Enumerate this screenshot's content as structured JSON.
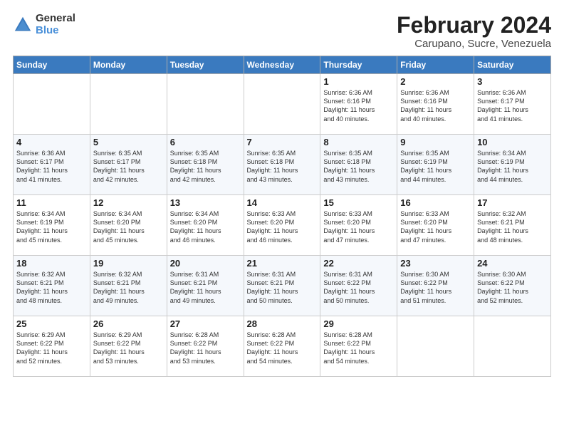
{
  "header": {
    "logo_general": "General",
    "logo_blue": "Blue",
    "title": "February 2024",
    "subtitle": "Carupano, Sucre, Venezuela"
  },
  "days_of_week": [
    "Sunday",
    "Monday",
    "Tuesday",
    "Wednesday",
    "Thursday",
    "Friday",
    "Saturday"
  ],
  "weeks": [
    [
      {
        "day": "",
        "info": ""
      },
      {
        "day": "",
        "info": ""
      },
      {
        "day": "",
        "info": ""
      },
      {
        "day": "",
        "info": ""
      },
      {
        "day": "1",
        "info": "Sunrise: 6:36 AM\nSunset: 6:16 PM\nDaylight: 11 hours\nand 40 minutes."
      },
      {
        "day": "2",
        "info": "Sunrise: 6:36 AM\nSunset: 6:16 PM\nDaylight: 11 hours\nand 40 minutes."
      },
      {
        "day": "3",
        "info": "Sunrise: 6:36 AM\nSunset: 6:17 PM\nDaylight: 11 hours\nand 41 minutes."
      }
    ],
    [
      {
        "day": "4",
        "info": "Sunrise: 6:36 AM\nSunset: 6:17 PM\nDaylight: 11 hours\nand 41 minutes."
      },
      {
        "day": "5",
        "info": "Sunrise: 6:35 AM\nSunset: 6:17 PM\nDaylight: 11 hours\nand 42 minutes."
      },
      {
        "day": "6",
        "info": "Sunrise: 6:35 AM\nSunset: 6:18 PM\nDaylight: 11 hours\nand 42 minutes."
      },
      {
        "day": "7",
        "info": "Sunrise: 6:35 AM\nSunset: 6:18 PM\nDaylight: 11 hours\nand 43 minutes."
      },
      {
        "day": "8",
        "info": "Sunrise: 6:35 AM\nSunset: 6:18 PM\nDaylight: 11 hours\nand 43 minutes."
      },
      {
        "day": "9",
        "info": "Sunrise: 6:35 AM\nSunset: 6:19 PM\nDaylight: 11 hours\nand 44 minutes."
      },
      {
        "day": "10",
        "info": "Sunrise: 6:34 AM\nSunset: 6:19 PM\nDaylight: 11 hours\nand 44 minutes."
      }
    ],
    [
      {
        "day": "11",
        "info": "Sunrise: 6:34 AM\nSunset: 6:19 PM\nDaylight: 11 hours\nand 45 minutes."
      },
      {
        "day": "12",
        "info": "Sunrise: 6:34 AM\nSunset: 6:20 PM\nDaylight: 11 hours\nand 45 minutes."
      },
      {
        "day": "13",
        "info": "Sunrise: 6:34 AM\nSunset: 6:20 PM\nDaylight: 11 hours\nand 46 minutes."
      },
      {
        "day": "14",
        "info": "Sunrise: 6:33 AM\nSunset: 6:20 PM\nDaylight: 11 hours\nand 46 minutes."
      },
      {
        "day": "15",
        "info": "Sunrise: 6:33 AM\nSunset: 6:20 PM\nDaylight: 11 hours\nand 47 minutes."
      },
      {
        "day": "16",
        "info": "Sunrise: 6:33 AM\nSunset: 6:20 PM\nDaylight: 11 hours\nand 47 minutes."
      },
      {
        "day": "17",
        "info": "Sunrise: 6:32 AM\nSunset: 6:21 PM\nDaylight: 11 hours\nand 48 minutes."
      }
    ],
    [
      {
        "day": "18",
        "info": "Sunrise: 6:32 AM\nSunset: 6:21 PM\nDaylight: 11 hours\nand 48 minutes."
      },
      {
        "day": "19",
        "info": "Sunrise: 6:32 AM\nSunset: 6:21 PM\nDaylight: 11 hours\nand 49 minutes."
      },
      {
        "day": "20",
        "info": "Sunrise: 6:31 AM\nSunset: 6:21 PM\nDaylight: 11 hours\nand 49 minutes."
      },
      {
        "day": "21",
        "info": "Sunrise: 6:31 AM\nSunset: 6:21 PM\nDaylight: 11 hours\nand 50 minutes."
      },
      {
        "day": "22",
        "info": "Sunrise: 6:31 AM\nSunset: 6:22 PM\nDaylight: 11 hours\nand 50 minutes."
      },
      {
        "day": "23",
        "info": "Sunrise: 6:30 AM\nSunset: 6:22 PM\nDaylight: 11 hours\nand 51 minutes."
      },
      {
        "day": "24",
        "info": "Sunrise: 6:30 AM\nSunset: 6:22 PM\nDaylight: 11 hours\nand 52 minutes."
      }
    ],
    [
      {
        "day": "25",
        "info": "Sunrise: 6:29 AM\nSunset: 6:22 PM\nDaylight: 11 hours\nand 52 minutes."
      },
      {
        "day": "26",
        "info": "Sunrise: 6:29 AM\nSunset: 6:22 PM\nDaylight: 11 hours\nand 53 minutes."
      },
      {
        "day": "27",
        "info": "Sunrise: 6:28 AM\nSunset: 6:22 PM\nDaylight: 11 hours\nand 53 minutes."
      },
      {
        "day": "28",
        "info": "Sunrise: 6:28 AM\nSunset: 6:22 PM\nDaylight: 11 hours\nand 54 minutes."
      },
      {
        "day": "29",
        "info": "Sunrise: 6:28 AM\nSunset: 6:22 PM\nDaylight: 11 hours\nand 54 minutes."
      },
      {
        "day": "",
        "info": ""
      },
      {
        "day": "",
        "info": ""
      }
    ]
  ]
}
